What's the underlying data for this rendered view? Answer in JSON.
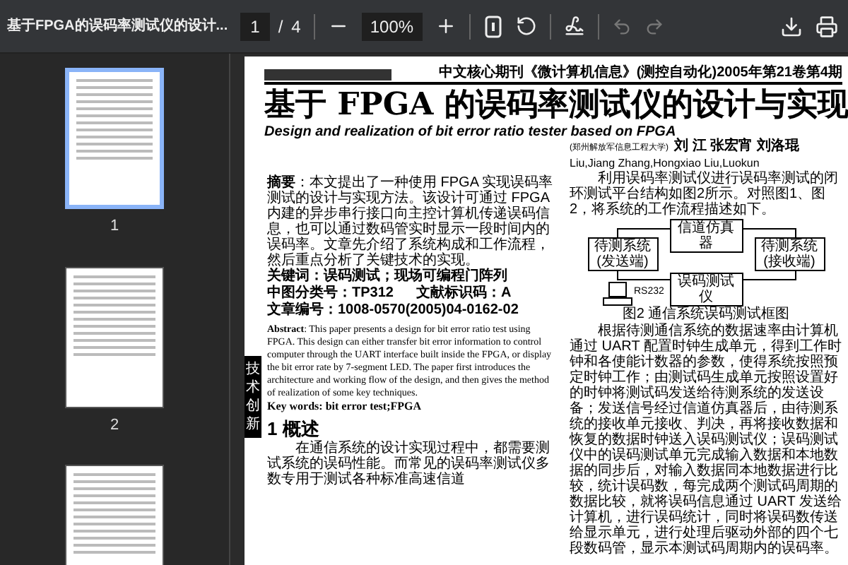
{
  "toolbar": {
    "title": "基于FPGA的误码率测试仪的设计...",
    "page_current": "1",
    "page_separator": "/",
    "page_total": "4",
    "zoom": "100%",
    "history": [
      {
        "kind": "undo",
        "disabled": true
      },
      {
        "kind": "redo",
        "disabled": true
      }
    ]
  },
  "thumbnails": [
    {
      "label": "1",
      "selected": true
    },
    {
      "label": "2",
      "selected": false
    },
    {
      "selected": false
    }
  ],
  "document": {
    "side_label": "技术创新",
    "journal_header": "中文核心期刊《微计算机信息》(测控自动化)2005年第21卷第4期",
    "title": "基于 FPGA 的误码率测试仪的设计与实现",
    "title_en": "Design and realization of bit error ratio tester based on FPGA",
    "affiliation": "(郑州解放军信息工程大学)",
    "authors": "刘 江 张宏宵 刘洛琨",
    "authors_en": "Liu,Jiang Zhang,Hongxiao Liu,Luokun",
    "abstract_cn": "**摘要**：本文提出了一种使用 FPGA 实现误码率测试的设计与实现方法。该设计可通过 FPGA 内建的异步串行接口向主控计算机传递误码信息，也可以通过数码管实时显示一段时间内的误码率。文章先介绍了系统构成和工作流程，然后重点分析了关键技术的实现。",
    "keywords_cn": "关键词：误码测试；现场可编程门阵列",
    "classification": "中图分类号：TP312",
    "document_code": "文献标识码：A",
    "article_number": "文章编号：1008-0570(2005)04-0162-02",
    "abstract_en": "**Abstract**: This paper presents a design for bit error ratio test using FPGA. This design can either transfer bit error information to control computer through the UART interface built inside the FPGA, or display the bit error rate by 7-segment LED. The paper first introduces the architecture and working flow of the design, and then gives the method of realization of some key techniques.",
    "keywords_en": "Key words: bit error test;FPGA",
    "section_heading": "1 概述",
    "section_text": "在通信系统的设计实现过程中，都需要测试系统的误码性能。而常见的误码率测试仪多数专用于测试各种标准高速信道",
    "intro_text": "利用误码率测试仪进行误码率测试的闭环测试平台结构如图2所示。对照图1、图2，将系统的工作流程描述如下。",
    "diagram": {
      "channel": "信道仿真器",
      "sender": "待测系统(发送端)",
      "receiver": "待测系统(接收端)",
      "tester": "误码测试仪",
      "port": "RS232",
      "caption": "图2 通信系统误码测试框图"
    },
    "body_text": "根据待测通信系统的数据速率由计算机通过 UART 配置时钟生成单元，得到工作时钟和各使能计数器的参数，使得系统按照预定时钟工作；由测试码生成单元按照设置好的时钟将测试码发送给待测系统的发送设备；发送信号经过信道仿真器后，由待测系统的接收单元接收、判决，再将接收数据和恢复的数据时钟送入误码测试仪；误码测试仪中的误码测试单元完成输入数据和本地数据的同步后，对输入数据同本地数据进行比较，统计误码数，每完成两个测试码周期的数据比较，就将误码信息通过 UART 发送给计算机，进行误码统计，同时将误码数传送给显示单元，进行处理后驱动外部的四个七段数码管，显示本测试码周期内的误码率。"
  }
}
